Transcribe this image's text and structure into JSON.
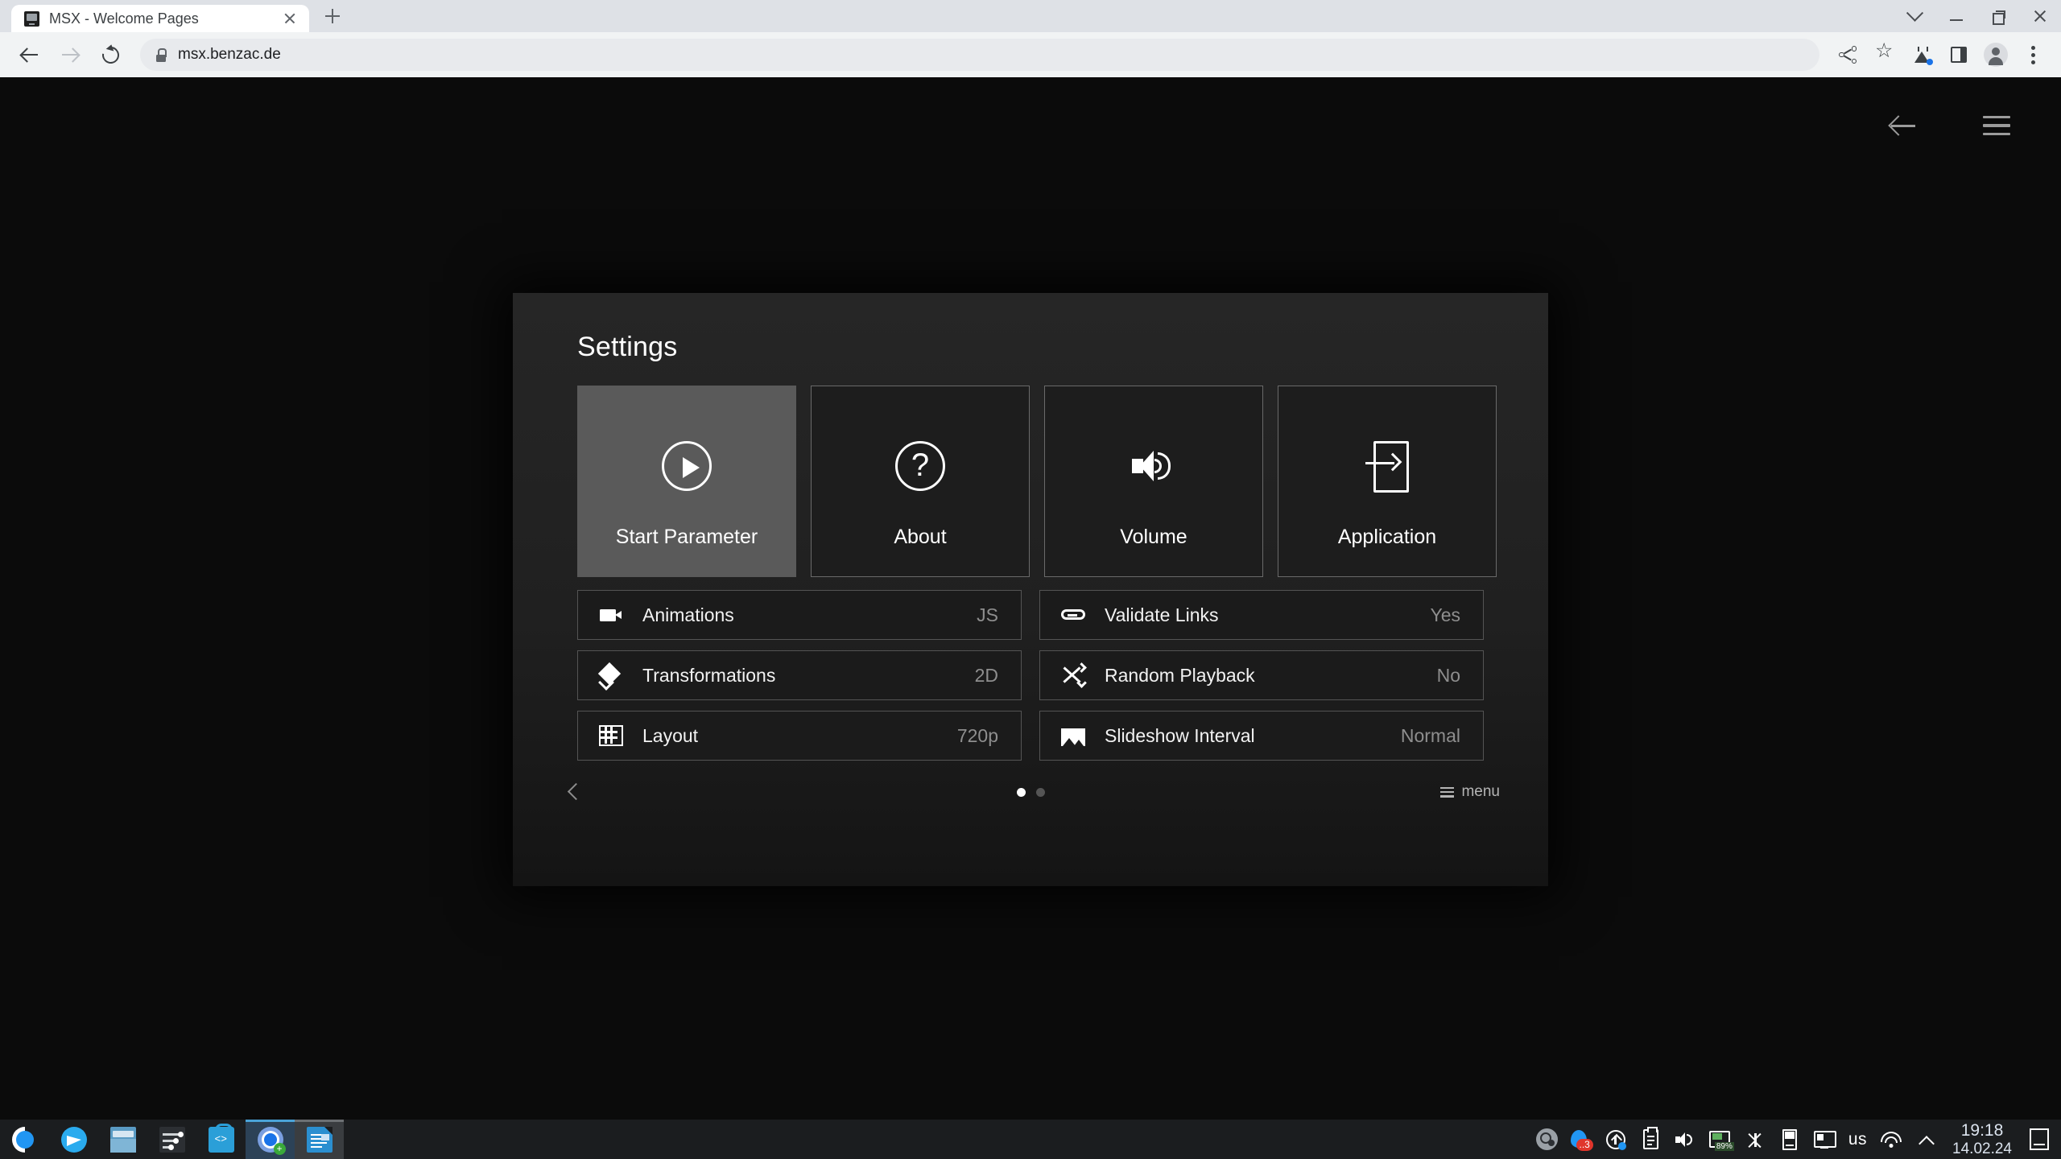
{
  "browser": {
    "tab": {
      "title": "MSX - Welcome Pages",
      "favicon": "monitor-icon",
      "close": "×"
    },
    "newtab_label": "+",
    "url": "msx.benzac.de",
    "nav": {
      "back": "←",
      "forward": "→",
      "reload": "⟳"
    },
    "window_controls": {
      "chevron": "⌄",
      "minimize": "—",
      "maximize": "❐",
      "close": "✕"
    },
    "toolbar_icons": [
      "share-icon",
      "bookmark-star-icon",
      "labs-flask-icon",
      "side-panel-icon",
      "profile-avatar-icon",
      "kebab-menu-icon"
    ]
  },
  "page": {
    "topbar": {
      "back_icon": "arrow-left-icon",
      "menu_icon": "hamburger-menu-icon"
    },
    "settings": {
      "title": "Settings",
      "tiles": [
        {
          "label": "Start Parameter",
          "icon": "play-circle-icon",
          "selected": true
        },
        {
          "label": "About",
          "icon": "help-circle-icon",
          "selected": false
        },
        {
          "label": "Volume",
          "icon": "volume-up-icon",
          "selected": false
        },
        {
          "label": "Application",
          "icon": "exit-to-app-icon",
          "selected": false
        }
      ],
      "rows": [
        {
          "label": "Animations",
          "value": "JS",
          "icon": "videocam-icon"
        },
        {
          "label": "Validate Links",
          "value": "Yes",
          "icon": "link-icon"
        },
        {
          "label": "Transformations",
          "value": "2D",
          "icon": "layers-icon"
        },
        {
          "label": "Random Playback",
          "value": "No",
          "icon": "shuffle-icon"
        },
        {
          "label": "Layout",
          "value": "720p",
          "icon": "grid-icon"
        },
        {
          "label": "Slideshow Interval",
          "value": "Normal",
          "icon": "image-icon"
        }
      ],
      "footer": {
        "prev_icon": "chevron-left-icon",
        "pages": 2,
        "active_page": 1,
        "menu_label": "menu",
        "menu_icon": "list-menu-icon"
      }
    }
  },
  "taskbar": {
    "launchers": [
      {
        "name": "kde-launcher",
        "state": "idle"
      },
      {
        "name": "telegram",
        "state": "idle"
      },
      {
        "name": "file-manager",
        "state": "idle"
      },
      {
        "name": "system-settings",
        "state": "idle"
      },
      {
        "name": "software-store",
        "state": "idle"
      },
      {
        "name": "chromium",
        "state": "active"
      },
      {
        "name": "libreoffice-writer",
        "state": "open"
      }
    ],
    "tray": {
      "steam": "steam-icon",
      "notifications_badge": "..3",
      "updates": "update-icon",
      "clipboard": "clipboard-icon",
      "volume": "volume-icon",
      "battery": "89%",
      "bluetooth": "bluetooth-icon",
      "usb": "usb-device-icon",
      "display": "display-icon",
      "keyboard_layout": "us",
      "network": "wifi-icon",
      "overflow": "chevron-up-icon",
      "show_desktop": "show-desktop-icon"
    },
    "clock": {
      "time": "19:18",
      "date": "14.02.24"
    }
  }
}
